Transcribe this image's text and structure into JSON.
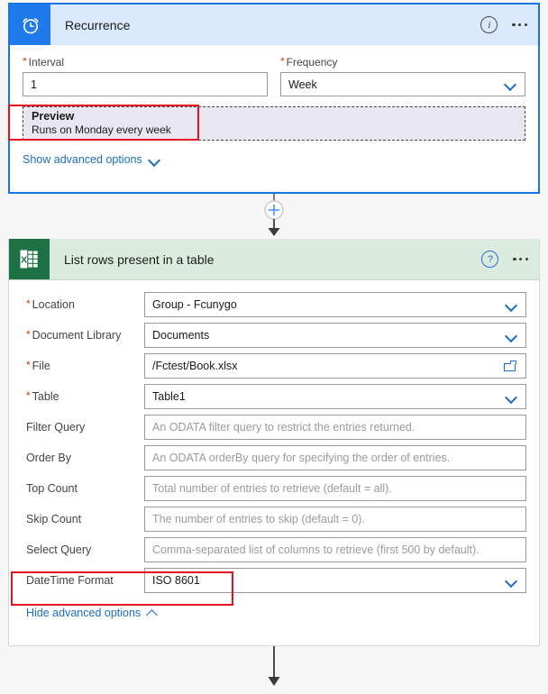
{
  "recurrence_card": {
    "icon": "alarm-clock-icon",
    "title": "Recurrence",
    "info_icon": "info-circle-icon",
    "more_icon": "ellipsis-menu-icon",
    "fields": [
      {
        "label": "Interval",
        "required": true,
        "value": "1",
        "type": "text"
      },
      {
        "label": "Frequency",
        "required": true,
        "value": "Week",
        "type": "dropdown"
      }
    ],
    "preview": {
      "title": "Preview",
      "subtitle": "Runs on Monday every week"
    },
    "advanced_link": {
      "label": "Show advanced options",
      "chevron": "chevron-down-icon"
    }
  },
  "connector_top": {
    "add_icon": "plus-circle-icon",
    "arrow_icon": "arrow-down-icon"
  },
  "connector_bottom": {
    "arrow_icon": "arrow-down-icon"
  },
  "excel_card": {
    "icon": "excel-icon",
    "title": "List rows present in a table",
    "help_icon": "help-circle-icon",
    "more_icon": "ellipsis-menu-icon",
    "fields": [
      {
        "label": "Location",
        "required": true,
        "value": "Group - Fcunygo",
        "placeholder": "",
        "type": "dropdown"
      },
      {
        "label": "Document Library",
        "required": true,
        "value": "Documents",
        "placeholder": "",
        "type": "dropdown"
      },
      {
        "label": "File",
        "required": true,
        "value": "/Fctest/Book.xlsx",
        "placeholder": "",
        "type": "filepicker"
      },
      {
        "label": "Table",
        "required": true,
        "value": "Table1",
        "placeholder": "",
        "type": "dropdown"
      },
      {
        "label": "Filter Query",
        "required": false,
        "value": "",
        "placeholder": "An ODATA filter query to restrict the entries returned.",
        "type": "text"
      },
      {
        "label": "Order By",
        "required": false,
        "value": "",
        "placeholder": "An ODATA orderBy query for specifying the order of entries.",
        "type": "text"
      },
      {
        "label": "Top Count",
        "required": false,
        "value": "",
        "placeholder": "Total number of entries to retrieve (default = all).",
        "type": "text"
      },
      {
        "label": "Skip Count",
        "required": false,
        "value": "",
        "placeholder": "The number of entries to skip (default = 0).",
        "type": "text"
      },
      {
        "label": "Select Query",
        "required": false,
        "value": "",
        "placeholder": "Comma-separated list of columns to retrieve (first 500 by default).",
        "type": "text"
      },
      {
        "label": "DateTime Format",
        "required": false,
        "value": "ISO 8601",
        "placeholder": "",
        "type": "dropdown"
      }
    ],
    "advanced_link": {
      "label": "Hide advanced options",
      "chevron": "chevron-up-icon"
    }
  },
  "annotations": [
    {
      "name": "preview-highlight",
      "color": "#e81123"
    },
    {
      "name": "datetime-highlight",
      "color": "#e81123"
    }
  ],
  "colors": {
    "recurrence_header": "#dbe9fc",
    "recurrence_badge": "#1f7aec",
    "recurrence_border": "#1a73e8",
    "excel_header": "#dcebe0",
    "excel_badge": "#1e7145",
    "link_blue": "#1b6ec2",
    "required_star": "#d83b01",
    "preview_bg": "#e8e6f0",
    "annotation_red": "#e81123"
  }
}
